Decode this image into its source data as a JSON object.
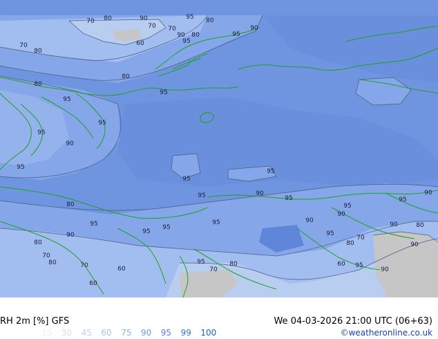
{
  "map": {
    "contour_labels": [
      "70",
      "80",
      "90",
      "95",
      "80",
      "70",
      "70",
      "90",
      "80",
      "95",
      "90",
      "60",
      "95",
      "70",
      "80",
      "80",
      "95",
      "80",
      "95",
      "95",
      "95",
      "90",
      "95",
      "95",
      "95",
      "95",
      "90",
      "95",
      "80",
      "95",
      "90",
      "95",
      "90",
      "95",
      "95",
      "95",
      "95",
      "90",
      "90",
      "95",
      "80",
      "70",
      "90",
      "80",
      "80",
      "90",
      "70",
      "80",
      "80",
      "70",
      "60",
      "95",
      "70",
      "60",
      "95",
      "90",
      "60"
    ],
    "colors": {
      "rh_95": "#6f94e0",
      "rh_90": "#85a7ea",
      "rh_80": "#a2bef0",
      "rh_70": "#b8cdf0",
      "rh_60": "#c6c6c6",
      "coastline": "#1ca21c",
      "contour": "#4a5a7a"
    }
  },
  "footer": {
    "title": "RH 2m [%] GFS",
    "datetime": "We 04-03-2026 21:00 UTC (06+63)",
    "credit": "©weatheronline.co.uk",
    "legend": [
      {
        "label": "15",
        "color": "#e9eef9"
      },
      {
        "label": "30",
        "color": "#d5e0f5"
      },
      {
        "label": "45",
        "color": "#bcd0f3"
      },
      {
        "label": "60",
        "color": "#a4c1f2"
      },
      {
        "label": "75",
        "color": "#8cb2ee"
      },
      {
        "label": "90",
        "color": "#6f9ae8"
      },
      {
        "label": "95",
        "color": "#4f82e0"
      },
      {
        "label": "99",
        "color": "#3470d6"
      },
      {
        "label": "100",
        "color": "#1a5cc8"
      }
    ]
  }
}
